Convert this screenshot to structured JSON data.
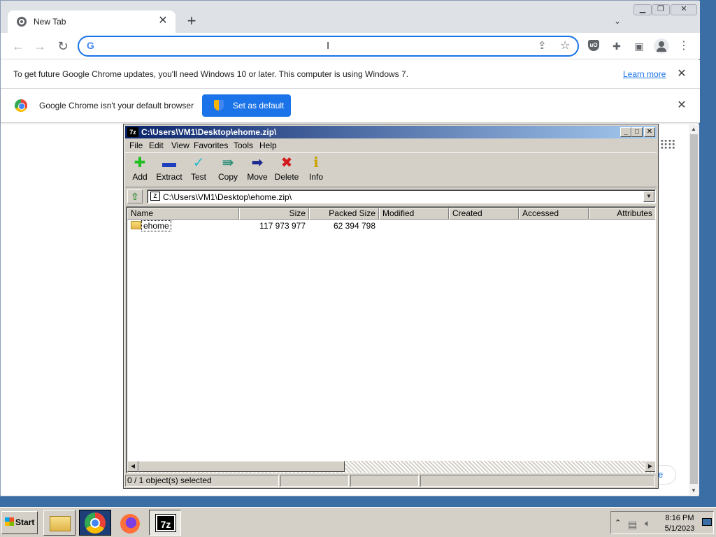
{
  "chrome": {
    "tab_title": "New Tab",
    "omnibox_value": "",
    "omnibox_google_glyph": "G",
    "infobar_update": {
      "message": "To get future Google Chrome updates, you'll need Windows 10 or later. This computer is using Windows 7.",
      "link": "Learn more"
    },
    "infobar_default": {
      "message": "Google Chrome isn't your default browser",
      "button": "Set as default"
    },
    "customize_partial": "e",
    "accent_color": "#1a73e8",
    "icons": [
      "chrome-tab-favicon",
      "close-icon",
      "plus-icon",
      "chevron-down-icon",
      "back-arrow-icon",
      "forward-arrow-icon",
      "reload-icon",
      "share-icon",
      "star-icon",
      "ublock-icon",
      "puzzle-icon",
      "side-panel-icon",
      "profile-icon",
      "kebab-menu-icon",
      "apps-grid-icon"
    ]
  },
  "zip": {
    "title": "C:\\Users\\VM1\\Desktop\\ehome.zip\\",
    "app_icon_text": "7z",
    "menu": [
      "File",
      "Edit",
      "View",
      "Favorites",
      "Tools",
      "Help"
    ],
    "toolbar": [
      "Add",
      "Extract",
      "Test",
      "Copy",
      "Move",
      "Delete",
      "Info"
    ],
    "path": "C:\\Users\\VM1\\Desktop\\ehome.zip\\",
    "columns": [
      "Name",
      "Size",
      "Packed Size",
      "Modified",
      "Created",
      "Accessed",
      "Attributes"
    ],
    "rows": [
      {
        "name": "ehome",
        "size": "117 973 977",
        "packed": "62 394 798"
      }
    ],
    "status": "0 / 1 object(s) selected"
  },
  "taskbar": {
    "start": "Start",
    "taskbar_7zip_label": "7z",
    "time": "8:16 PM",
    "date": "5/1/2023"
  }
}
